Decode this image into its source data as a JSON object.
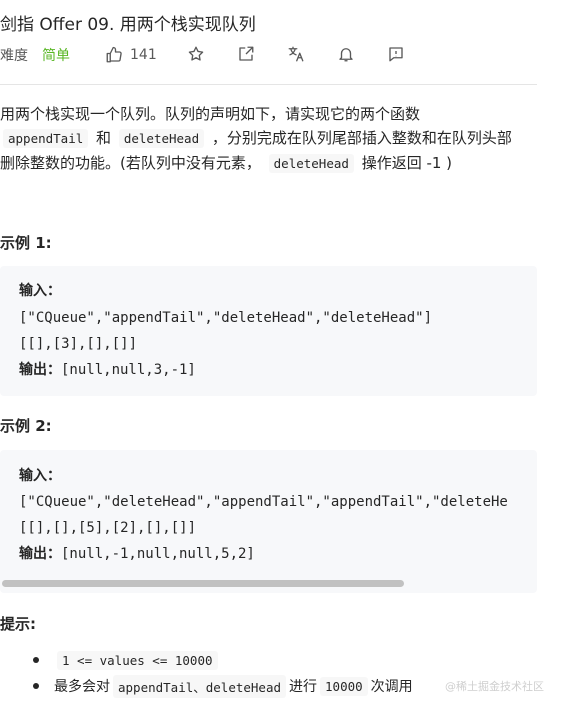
{
  "problem": {
    "title": "剑指 Offer 09. 用两个栈实现队列",
    "difficulty_label": "难度",
    "difficulty_value": "简单",
    "likes": "141"
  },
  "description": {
    "line1": "用两个栈实现一个队列。队列的声明如下，请实现它的两个函数",
    "code_append": "appendTail",
    "and": "和",
    "code_delete": "deleteHead",
    "line2_rest": "，分别完成在队列尾部插入整数和在队列头部",
    "line3_a": "删除整数的功能。(若队列中没有元素，",
    "code_delete2": "deleteHead",
    "line3_b": "操作返回 -1 )"
  },
  "example1": {
    "heading": "示例 1:",
    "input_label": "输入：",
    "line1": "[\"CQueue\",\"appendTail\",\"deleteHead\",\"deleteHead\"]",
    "line2": "[[],[3],[],[]]",
    "output_label": "输出：",
    "output": "[null,null,3,-1]"
  },
  "example2": {
    "heading": "示例 2:",
    "input_label": "输入：",
    "line1": "[\"CQueue\",\"deleteHead\",\"appendTail\",\"appendTail\",\"deleteHe",
    "line2": "[[],[],[5],[2],[],[]]",
    "output_label": "输出：",
    "output": "[null,-1,null,null,5,2]"
  },
  "tips": {
    "heading": "提示:",
    "tip1_code": "1 <= values <= 10000",
    "tip2_a": "最多会对",
    "tip2_code1": "appendTail、deleteHead",
    "tip2_b": "进行",
    "tip2_code2": "10000",
    "tip2_c": "次调用"
  },
  "watermark": "@稀土掘金技术社区",
  "icons": [
    "thumbs-up-icon",
    "star-icon",
    "share-icon",
    "translate-icon",
    "bell-icon",
    "feedback-icon"
  ],
  "colors": {
    "difficulty_easy": "#5ab726",
    "code_bg": "#f7f8fa",
    "text": "#262626"
  }
}
